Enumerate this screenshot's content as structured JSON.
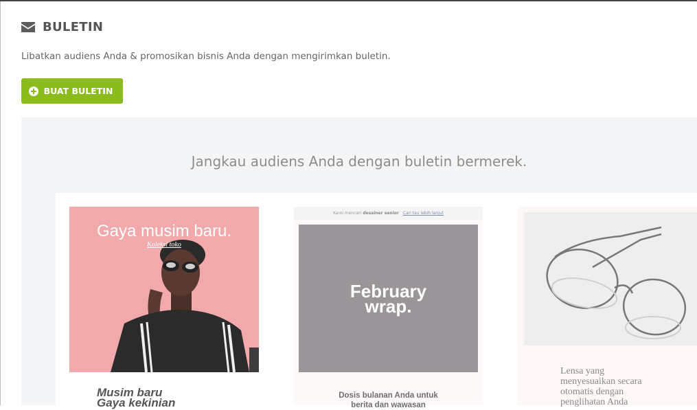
{
  "header": {
    "icon": "envelope-icon",
    "title": "BULETIN",
    "description": "Libatkan audiens Anda & promosikan bisnis Anda dengan mengirimkan buletin."
  },
  "actions": {
    "create_label": "BUAT BULETIN",
    "create_icon": "plus-circle-icon",
    "accent_color": "#8cbb1e"
  },
  "showcase": {
    "tagline": "Jangkau audiens Anda dengan buletin bermerek.",
    "cards": [
      {
        "image_title": "Gaya musim baru.",
        "image_link": "Koleksi toko",
        "caption_line1": "Musim baru",
        "caption_line2": "Gaya kekinian"
      },
      {
        "topbar_text": "Kami mencari",
        "topbar_strong": "desainer senior",
        "topbar_link": "Cari tau lebih lanjut",
        "image_text": "February\nwrap.",
        "caption_line1": "Dosis bulanan Anda untuk",
        "caption_line2": "berita dan wawasan"
      },
      {
        "caption_line1": "Lensa yang",
        "caption_line2": "menyesuaikan secara",
        "caption_line3": "otomatis dengan",
        "caption_line4": "penglihatan Anda"
      }
    ]
  }
}
